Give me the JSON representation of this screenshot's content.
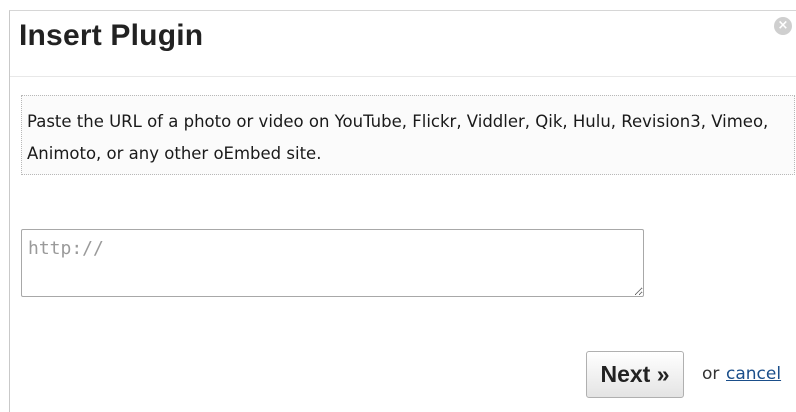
{
  "dialog": {
    "title": "Insert Plugin",
    "close_glyph": "×",
    "close_icon": "close-icon",
    "info_text": "Paste the URL of a photo or video on YouTube, Flickr, Viddler, Qik, Hulu, Revision3, Vimeo, Animoto, or any other oEmbed site.",
    "url_input": {
      "value": "",
      "placeholder": "http://"
    },
    "next_label": "Next »",
    "or_text": "or",
    "cancel_label": "cancel"
  },
  "colors": {
    "title": "#222222",
    "link": "#1a4e8a",
    "close_icon_bg": "#cfcfcf",
    "info_border": "#b8b8b8"
  }
}
